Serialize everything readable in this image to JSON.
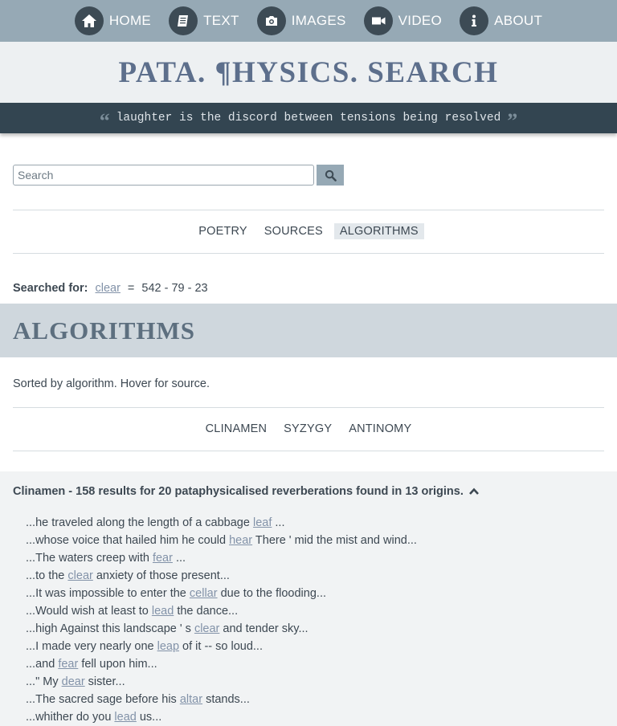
{
  "nav": {
    "items": [
      {
        "label": "HOME",
        "icon": "home-icon"
      },
      {
        "label": "TEXT",
        "icon": "book-icon"
      },
      {
        "label": "IMAGES",
        "icon": "camera-icon"
      },
      {
        "label": "VIDEO",
        "icon": "video-icon"
      },
      {
        "label": "ABOUT",
        "icon": "info-icon"
      }
    ]
  },
  "header": {
    "title": "PATA. ¶HYSICS. SEARCH",
    "quote": "laughter is the discord between tensions being resolved"
  },
  "search": {
    "placeholder": "Search",
    "value": "",
    "button_icon": "search-icon"
  },
  "mode_tabs": {
    "items": [
      "POETRY",
      "SOURCES",
      "ALGORITHMS"
    ],
    "active": "ALGORITHMS"
  },
  "searched_for": {
    "label": "Searched for:",
    "term": "clear",
    "equals": "=",
    "numbers": "542 - 79 - 23"
  },
  "section": {
    "title": "ALGORITHMS",
    "description": "Sorted by algorithm. Hover for source."
  },
  "algorithm_tabs": {
    "items": [
      "CLINAMEN",
      "SYZYGY",
      "ANTINOMY"
    ]
  },
  "results": {
    "heading": "Clinamen - 158 results for 20 pataphysicalised reverberations found in 13 origins.",
    "lines": [
      {
        "pre": "...he traveled along the length of a cabbage ",
        "word": "leaf",
        "post": " ..."
      },
      {
        "pre": "...whose voice that hailed him he could ",
        "word": "hear",
        "post": " There ' mid the mist and wind..."
      },
      {
        "pre": "...The waters creep with ",
        "word": "fear",
        "post": " ..."
      },
      {
        "pre": "...to the ",
        "word": "clear",
        "post": " anxiety of those present..."
      },
      {
        "pre": "...It was impossible to enter the ",
        "word": "cellar",
        "post": " due to the flooding..."
      },
      {
        "pre": "...Would wish at least to ",
        "word": "lead",
        "post": " the dance..."
      },
      {
        "pre": "...high Against this landscape ' s ",
        "word": "clear",
        "post": " and tender sky..."
      },
      {
        "pre": "...I made very nearly one ",
        "word": "leap",
        "post": " of it -- so loud..."
      },
      {
        "pre": "...and ",
        "word": "fear",
        "post": " fell upon him..."
      },
      {
        "pre": "...\" My ",
        "word": "dear",
        "post": " sister..."
      },
      {
        "pre": "...The sacred sage before his ",
        "word": "altar",
        "post": " stands..."
      },
      {
        "pre": "...whither do you ",
        "word": "lead",
        "post": " us..."
      }
    ]
  },
  "colors": {
    "nav_bg": "#96a9b5",
    "nav_icon_bg": "#3d4b55",
    "title_color": "#5d6f8c",
    "quote_bg": "#334551",
    "link_color": "#8292a8",
    "section_bg": "#cfd7dd"
  }
}
